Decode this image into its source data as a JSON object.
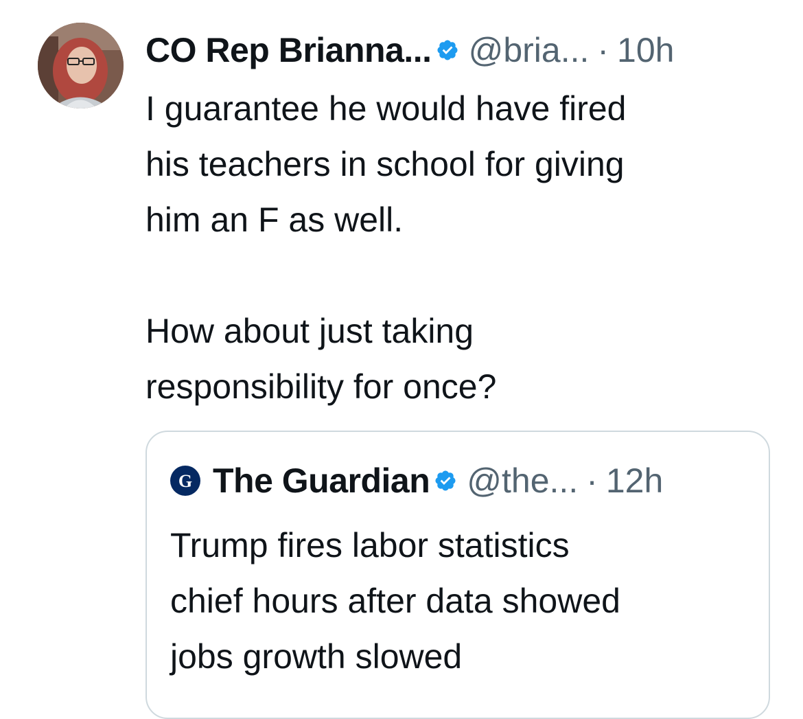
{
  "tweet": {
    "author": {
      "display_name": "CO Rep Brianna...",
      "handle": "@bria...",
      "time": "10h",
      "verified_icon": "verified-badge-icon"
    },
    "separator": "·",
    "text_paragraphs": [
      "I guarantee he would have fired\nhis teachers in school for giving\nhim an F as well.",
      "How about just taking\nresponsibility for once?"
    ]
  },
  "quote": {
    "author": {
      "display_name": "The Guardian",
      "handle": "@the...",
      "time": "12h",
      "logo_icon": "guardian-logo-icon",
      "verified_icon": "verified-badge-icon"
    },
    "text": "Trump fires labor statistics\nchief hours after data showed\njobs growth slowed"
  },
  "colors": {
    "verified_blue": "#1d9bf0",
    "secondary_text": "#536471",
    "border": "#cfd9de",
    "guardian_navy": "#052962"
  }
}
